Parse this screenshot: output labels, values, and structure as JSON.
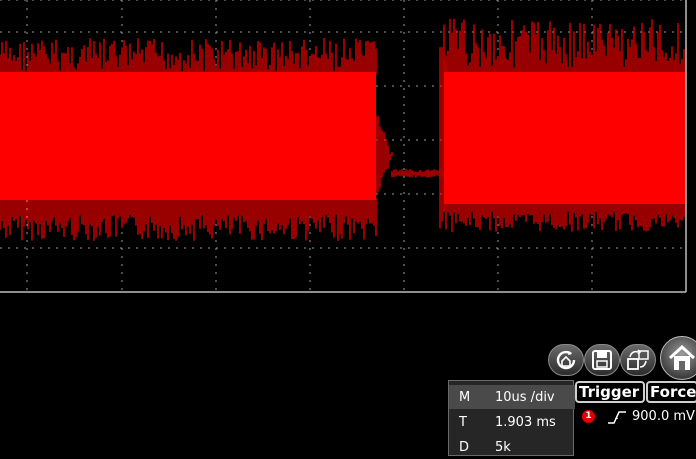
{
  "scope": {
    "trace_color": "#ff0000",
    "grid_color": "#9a9a9a",
    "background": "#000000"
  },
  "toolbar": {
    "buttons": [
      {
        "icon": "auto-scale-icon"
      },
      {
        "icon": "save-icon"
      },
      {
        "icon": "export-icon"
      },
      {
        "icon": "home-icon"
      }
    ]
  },
  "params": {
    "rows": [
      {
        "key": "M",
        "value": "10us /div"
      },
      {
        "key": "T",
        "value": "1.903 ms"
      },
      {
        "key": "D",
        "value": "5k"
      }
    ]
  },
  "trigger": {
    "trigger_label": "Trigger",
    "force_label": "Force",
    "channel": "1",
    "edge_icon": "rising-edge-icon",
    "level": "900.0 mV"
  }
}
